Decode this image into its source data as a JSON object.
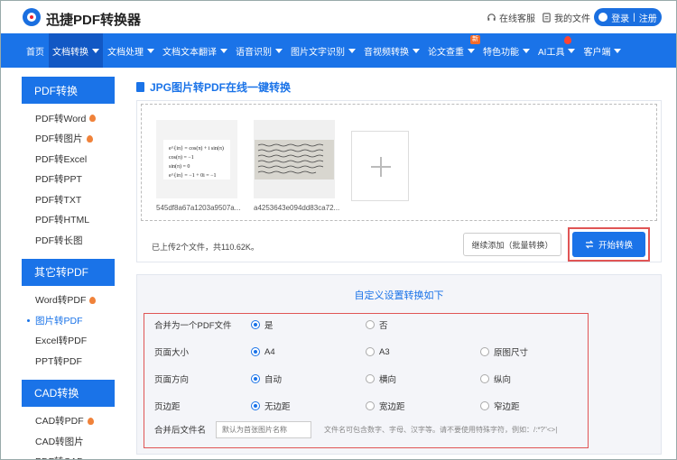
{
  "header": {
    "logo_text": "迅捷PDF转换器",
    "support_link": "在线客服",
    "files_link": "我的文件",
    "login_label": "登录",
    "register_label": "注册"
  },
  "nav": {
    "items": [
      {
        "label": "首页",
        "caret": false
      },
      {
        "label": "文档转换",
        "caret": true,
        "active": true
      },
      {
        "label": "文档处理",
        "caret": true
      },
      {
        "label": "文档文本翻译",
        "caret": true
      },
      {
        "label": "语音识别",
        "caret": true
      },
      {
        "label": "图片文字识别",
        "caret": true
      },
      {
        "label": "音视频转换",
        "caret": true
      },
      {
        "label": "论文查重",
        "caret": true,
        "badge": "新"
      },
      {
        "label": "特色功能",
        "caret": true
      },
      {
        "label": "AI工具",
        "caret": true,
        "hot": true
      },
      {
        "label": "客户端",
        "caret": true
      }
    ]
  },
  "sidebar": {
    "groups": [
      {
        "title": "PDF转换",
        "items": [
          {
            "label": "PDF转Word",
            "hot": true
          },
          {
            "label": "PDF转图片",
            "hot": true
          },
          {
            "label": "PDF转Excel"
          },
          {
            "label": "PDF转PPT"
          },
          {
            "label": "PDF转TXT"
          },
          {
            "label": "PDF转HTML"
          },
          {
            "label": "PDF转长图"
          }
        ]
      },
      {
        "title": "其它转PDF",
        "items": [
          {
            "label": "Word转PDF",
            "hot": true
          },
          {
            "label": "图片转PDF",
            "active": true
          },
          {
            "label": "Excel转PDF"
          },
          {
            "label": "PPT转PDF"
          }
        ]
      },
      {
        "title": "CAD转换",
        "items": [
          {
            "label": "CAD转PDF",
            "hot": true
          },
          {
            "label": "CAD转图片"
          },
          {
            "label": "PDF转CAD"
          }
        ]
      }
    ]
  },
  "main": {
    "title": "JPG图片转PDF在线一键转换",
    "files": [
      {
        "name": "545df8a67a1203a9507a..."
      },
      {
        "name": "a4253643e094dd83ca72..."
      }
    ],
    "formula_lines": [
      "e^{iπ} = cos(π) + i sin(π)",
      "cos(π) = −1",
      "sin(π) = 0",
      "e^{iπ} = −1 + 0i = −1"
    ],
    "upload_status": "已上传2个文件，共110.62K。",
    "continue_button": "继续添加（批量转换）",
    "convert_button": "开始转换"
  },
  "settings": {
    "title": "自定义设置转换如下",
    "rows": [
      {
        "label": "合并为一个PDF文件",
        "options": [
          "是",
          "否"
        ],
        "selected": 0
      },
      {
        "label": "页面大小",
        "options": [
          "A4",
          "A3",
          "原图尺寸"
        ],
        "selected": 0
      },
      {
        "label": "页面方向",
        "options": [
          "自动",
          "横向",
          "纵向"
        ],
        "selected": 0
      },
      {
        "label": "页边距",
        "options": [
          "无边距",
          "宽边距",
          "窄边距"
        ],
        "selected": 0
      }
    ],
    "filename_label": "合并后文件名",
    "filename_placeholder": "默认为首张图片名称",
    "filename_hint": "文件名可包含数字、字母、汉字等。请不要使用特殊字符，例如：/:*?\"<>|"
  }
}
